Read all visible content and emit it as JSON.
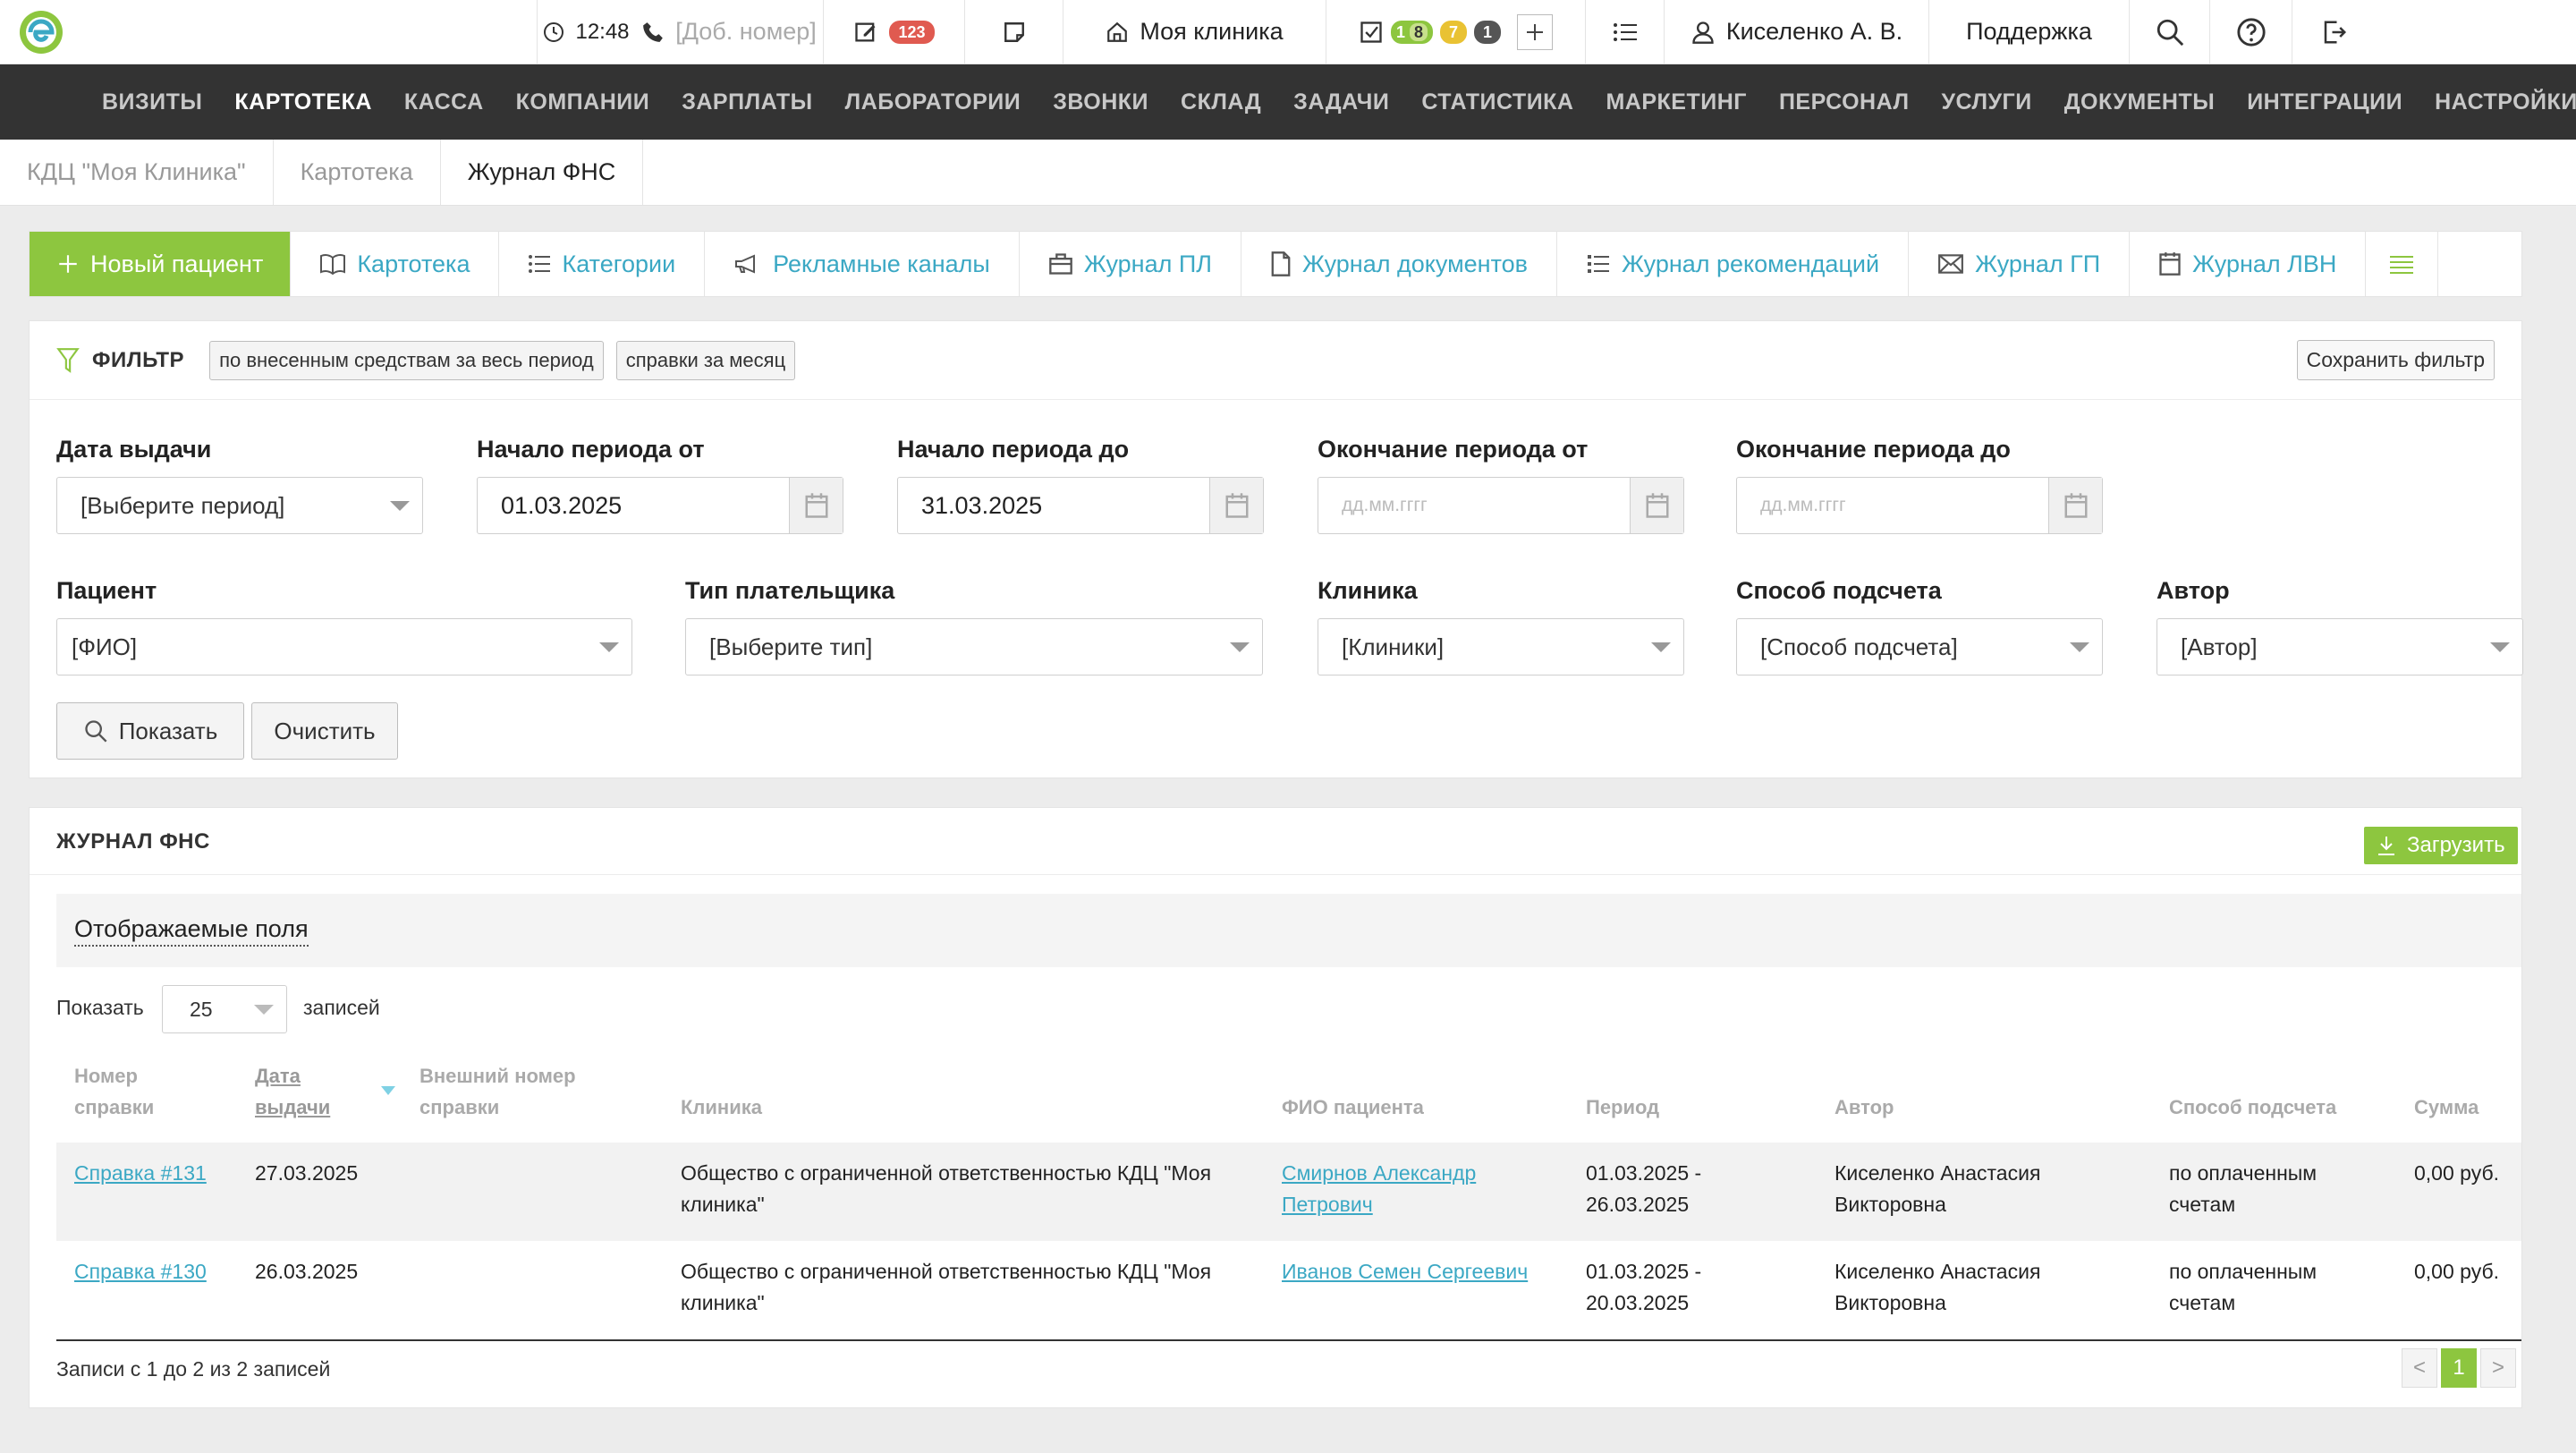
{
  "topbar": {
    "time": "12:48",
    "phone_placeholder": "[Доб. номер]",
    "notes_count": "123",
    "clinic": "Моя клиника",
    "tasks": {
      "done": "1",
      "mid": "8",
      "warn": "7",
      "other": "1"
    },
    "user": "Киселенко А. В.",
    "support": "Поддержка"
  },
  "nav": [
    "ВИЗИТЫ",
    "КАРТОТЕКА",
    "КАССА",
    "КОМПАНИИ",
    "ЗАРПЛАТЫ",
    "ЛАБОРАТОРИИ",
    "ЗВОНКИ",
    "СКЛАД",
    "ЗАДАЧИ",
    "СТАТИСТИКА",
    "МАРКЕТИНГ",
    "ПЕРСОНАЛ",
    "УСЛУГИ",
    "ДОКУМЕНТЫ",
    "ИНТЕГРАЦИИ",
    "НАСТРОЙКИ"
  ],
  "nav_active": "КАРТОТЕКА",
  "breadcrumb": [
    "КДЦ \"Моя Клиника\"",
    "Картотека",
    "Журнал ФНС"
  ],
  "tabs": {
    "new_patient": "Новый пациент",
    "items": [
      "Картотека",
      "Категории",
      "Рекламные каналы",
      "Журнал ПЛ",
      "Журнал документов",
      "Журнал рекомендаций",
      "Журнал ГП",
      "Журнал ЛВН"
    ]
  },
  "filter": {
    "title": "ФИЛЬТР",
    "chips": [
      "по внесенным средствам за весь период",
      "справки за месяц"
    ],
    "save": "Сохранить фильтр",
    "issue_date": {
      "label": "Дата выдачи",
      "value": "[Выберите период]"
    },
    "start_from": {
      "label": "Начало периода от",
      "value": "01.03.2025"
    },
    "start_to": {
      "label": "Начало периода до",
      "value": "31.03.2025"
    },
    "end_from": {
      "label": "Окончание периода от",
      "placeholder": "дд.мм.гггг"
    },
    "end_to": {
      "label": "Окончание периода до",
      "placeholder": "дд.мм.гггг"
    },
    "patient": {
      "label": "Пациент",
      "value": "[ФИО]"
    },
    "payer": {
      "label": "Тип плательщика",
      "value": "[Выберите тип]"
    },
    "clinic": {
      "label": "Клиника",
      "value": "[Клиники]"
    },
    "method": {
      "label": "Способ подсчета",
      "value": "[Способ подсчета]"
    },
    "author": {
      "label": "Автор",
      "value": "[Автор]"
    },
    "show": "Показать",
    "clear": "Очистить"
  },
  "journal": {
    "title": "ЖУРНАЛ ФНС",
    "download": "Загрузить",
    "fields": "Отображаемые поля",
    "show_label": "Показать",
    "page_size": "25",
    "records_label": "записей",
    "columns": {
      "num": [
        "Номер",
        "справки"
      ],
      "date": [
        "Дата",
        "выдачи"
      ],
      "ext": [
        "Внешний номер",
        "справки"
      ],
      "clinic": "Клиника",
      "patient": "ФИО пациента",
      "period": "Период",
      "author": "Автор",
      "method": "Способ подсчета",
      "sum": "Сумма"
    },
    "rows": [
      {
        "num": "Справка #131",
        "date": "27.03.2025",
        "ext": "",
        "clinic": [
          "Общество с ограниченной ответственностью КДЦ \"Моя",
          "клиника\""
        ],
        "patient": [
          "Смирнов Александр",
          "Петрович"
        ],
        "period": [
          "01.03.2025 -",
          "26.03.2025"
        ],
        "author": [
          "Киселенко Анастасия",
          "Викторовна"
        ],
        "method": [
          "по оплаченным",
          "счетам"
        ],
        "sum": "0,00 руб."
      },
      {
        "num": "Справка #130",
        "date": "26.03.2025",
        "ext": "",
        "clinic": [
          "Общество с ограниченной ответственностью КДЦ \"Моя",
          "клиника\""
        ],
        "patient": [
          "Иванов Семен Сергеевич",
          ""
        ],
        "period": [
          "01.03.2025 -",
          "20.03.2025"
        ],
        "author": [
          "Киселенко Анастасия",
          "Викторовна"
        ],
        "method": [
          "по оплаченным",
          "счетам"
        ],
        "sum": "0,00 руб."
      }
    ],
    "info": "Записи с 1 до 2 из 2 записей",
    "pager": {
      "prev": "<",
      "current": "1",
      "next": ">"
    }
  },
  "colors": {
    "accent_green": "#8dc63f",
    "link_blue": "#3ba8c4",
    "nav_bg": "#333333"
  }
}
